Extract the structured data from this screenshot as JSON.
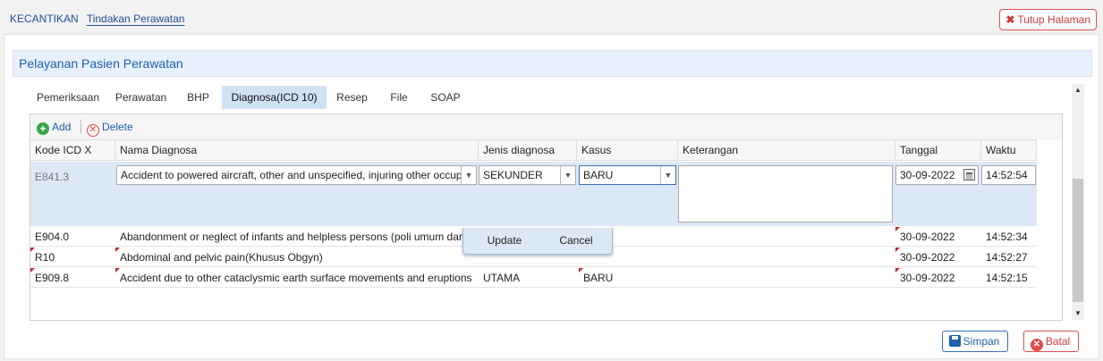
{
  "breadcrumb": {
    "root": "KECANTIKAN",
    "current": "Tindakan Perawatan"
  },
  "close_page_label": "Tutup Halaman",
  "panel_title": "Pelayanan Pasien Perawatan",
  "tabs": [
    "Pemeriksaan",
    "Perawatan",
    "BHP",
    "Diagnosa(ICD 10)",
    "Resep",
    "File",
    "SOAP"
  ],
  "active_tab": "Diagnosa(ICD 10)",
  "toolbar": {
    "add_label": "Add",
    "delete_label": "Delete"
  },
  "columns": [
    "Kode ICD X",
    "Nama Diagnosa",
    "Jenis diagnosa",
    "Kasus",
    "Keterangan",
    "Tanggal",
    "Waktu"
  ],
  "editor": {
    "kode": "E841.3",
    "nama": "Accident to powered aircraft, other and unspecified, injuring other occupants",
    "jenis": "SEKUNDER",
    "kasus": "BARU",
    "keterangan": "",
    "tanggal": "30-09-2022",
    "waktu": "14:52:54"
  },
  "rows": [
    {
      "kode": "E904.0",
      "nama": "Abandonment or neglect of infants and helpless persons (poli umum dan p",
      "jenis": "",
      "kasus": "",
      "tanggal": "30-09-2022",
      "waktu": "14:52:34"
    },
    {
      "kode": "R10",
      "nama": "Abdominal and pelvic pain(Khusus Obgyn)",
      "jenis": "",
      "kasus": "",
      "tanggal": "30-09-2022",
      "waktu": "14:52:27"
    },
    {
      "kode": "E909.8",
      "nama": "Accident due to other cataclysmic earth surface movements and eruptions",
      "jenis": "UTAMA",
      "kasus": "BARU",
      "tanggal": "30-09-2022",
      "waktu": "14:52:15"
    }
  ],
  "row_editor": {
    "update_label": "Update",
    "cancel_label": "Cancel"
  },
  "footer": {
    "save_label": "Simpan",
    "cancel_label": "Batal"
  },
  "colors": {
    "accent": "#1d5fb0",
    "danger": "#d23a3a",
    "active_tab": "#cfe2f3",
    "editor_bg": "#dce8f5"
  }
}
